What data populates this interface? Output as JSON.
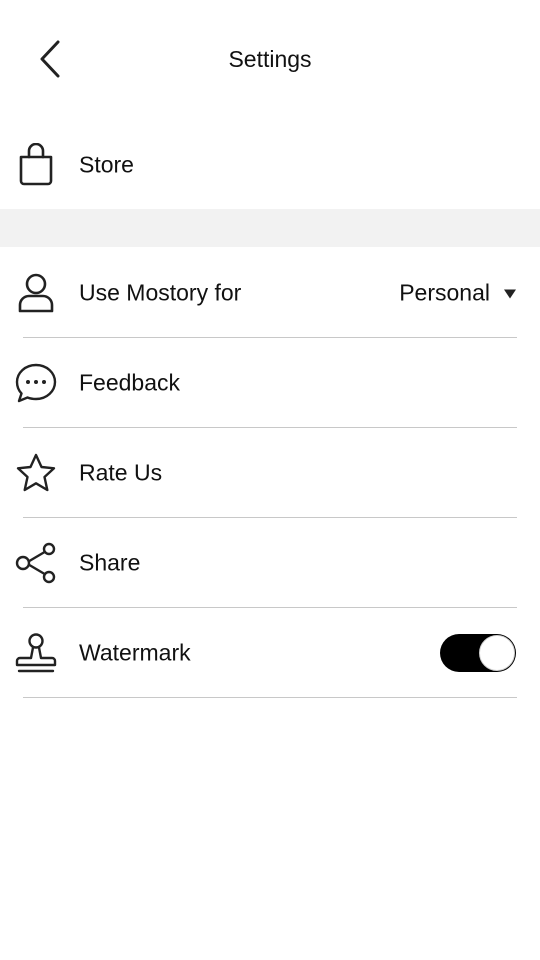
{
  "header": {
    "title": "Settings"
  },
  "store": {
    "label": "Store",
    "icon": "shopping-bag-icon"
  },
  "settings_items": [
    {
      "id": "use-mostory-for",
      "label": "Use Mostory for",
      "icon": "user-icon",
      "control": "select",
      "value": "Personal"
    },
    {
      "id": "feedback",
      "label": "Feedback",
      "icon": "chat-bubble-icon"
    },
    {
      "id": "rate-us",
      "label": "Rate Us",
      "icon": "star-icon"
    },
    {
      "id": "share",
      "label": "Share",
      "icon": "share-icon"
    },
    {
      "id": "watermark",
      "label": "Watermark",
      "icon": "stamp-icon",
      "control": "toggle",
      "enabled": true
    }
  ],
  "colors": {
    "text": "#111111",
    "divider": "#c8c8c8",
    "section_gap": "#f2f2f2",
    "toggle_on": "#000000"
  }
}
